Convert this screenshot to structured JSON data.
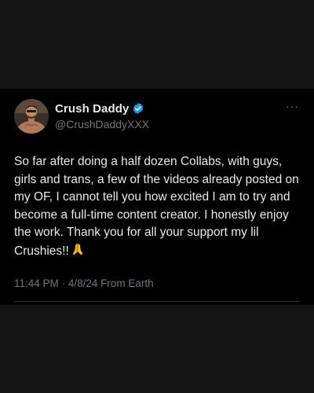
{
  "tweet": {
    "display_name": "Crush Daddy",
    "handle": "@CrushDaddyXXX",
    "verified": true,
    "more_label": "···",
    "text": "So far after doing a half dozen Collabs, with guys, girls and trans, a few of the videos already posted on my OF, I cannot tell you how excited I am to try and become a full-time content creator. I honestly enjoy the work. Thank you for all your support my lil Crushies!!",
    "emoji": "folded-hands-emoji",
    "time": "11:44 PM",
    "separator": "·",
    "date": "4/8/24",
    "source": "From Earth"
  },
  "colors": {
    "background": "#000000",
    "band": "#141414",
    "text_primary": "#e7e9ea",
    "text_secondary": "#71767b",
    "verified_blue": "#1d9bf0",
    "divider": "#2f3336"
  }
}
